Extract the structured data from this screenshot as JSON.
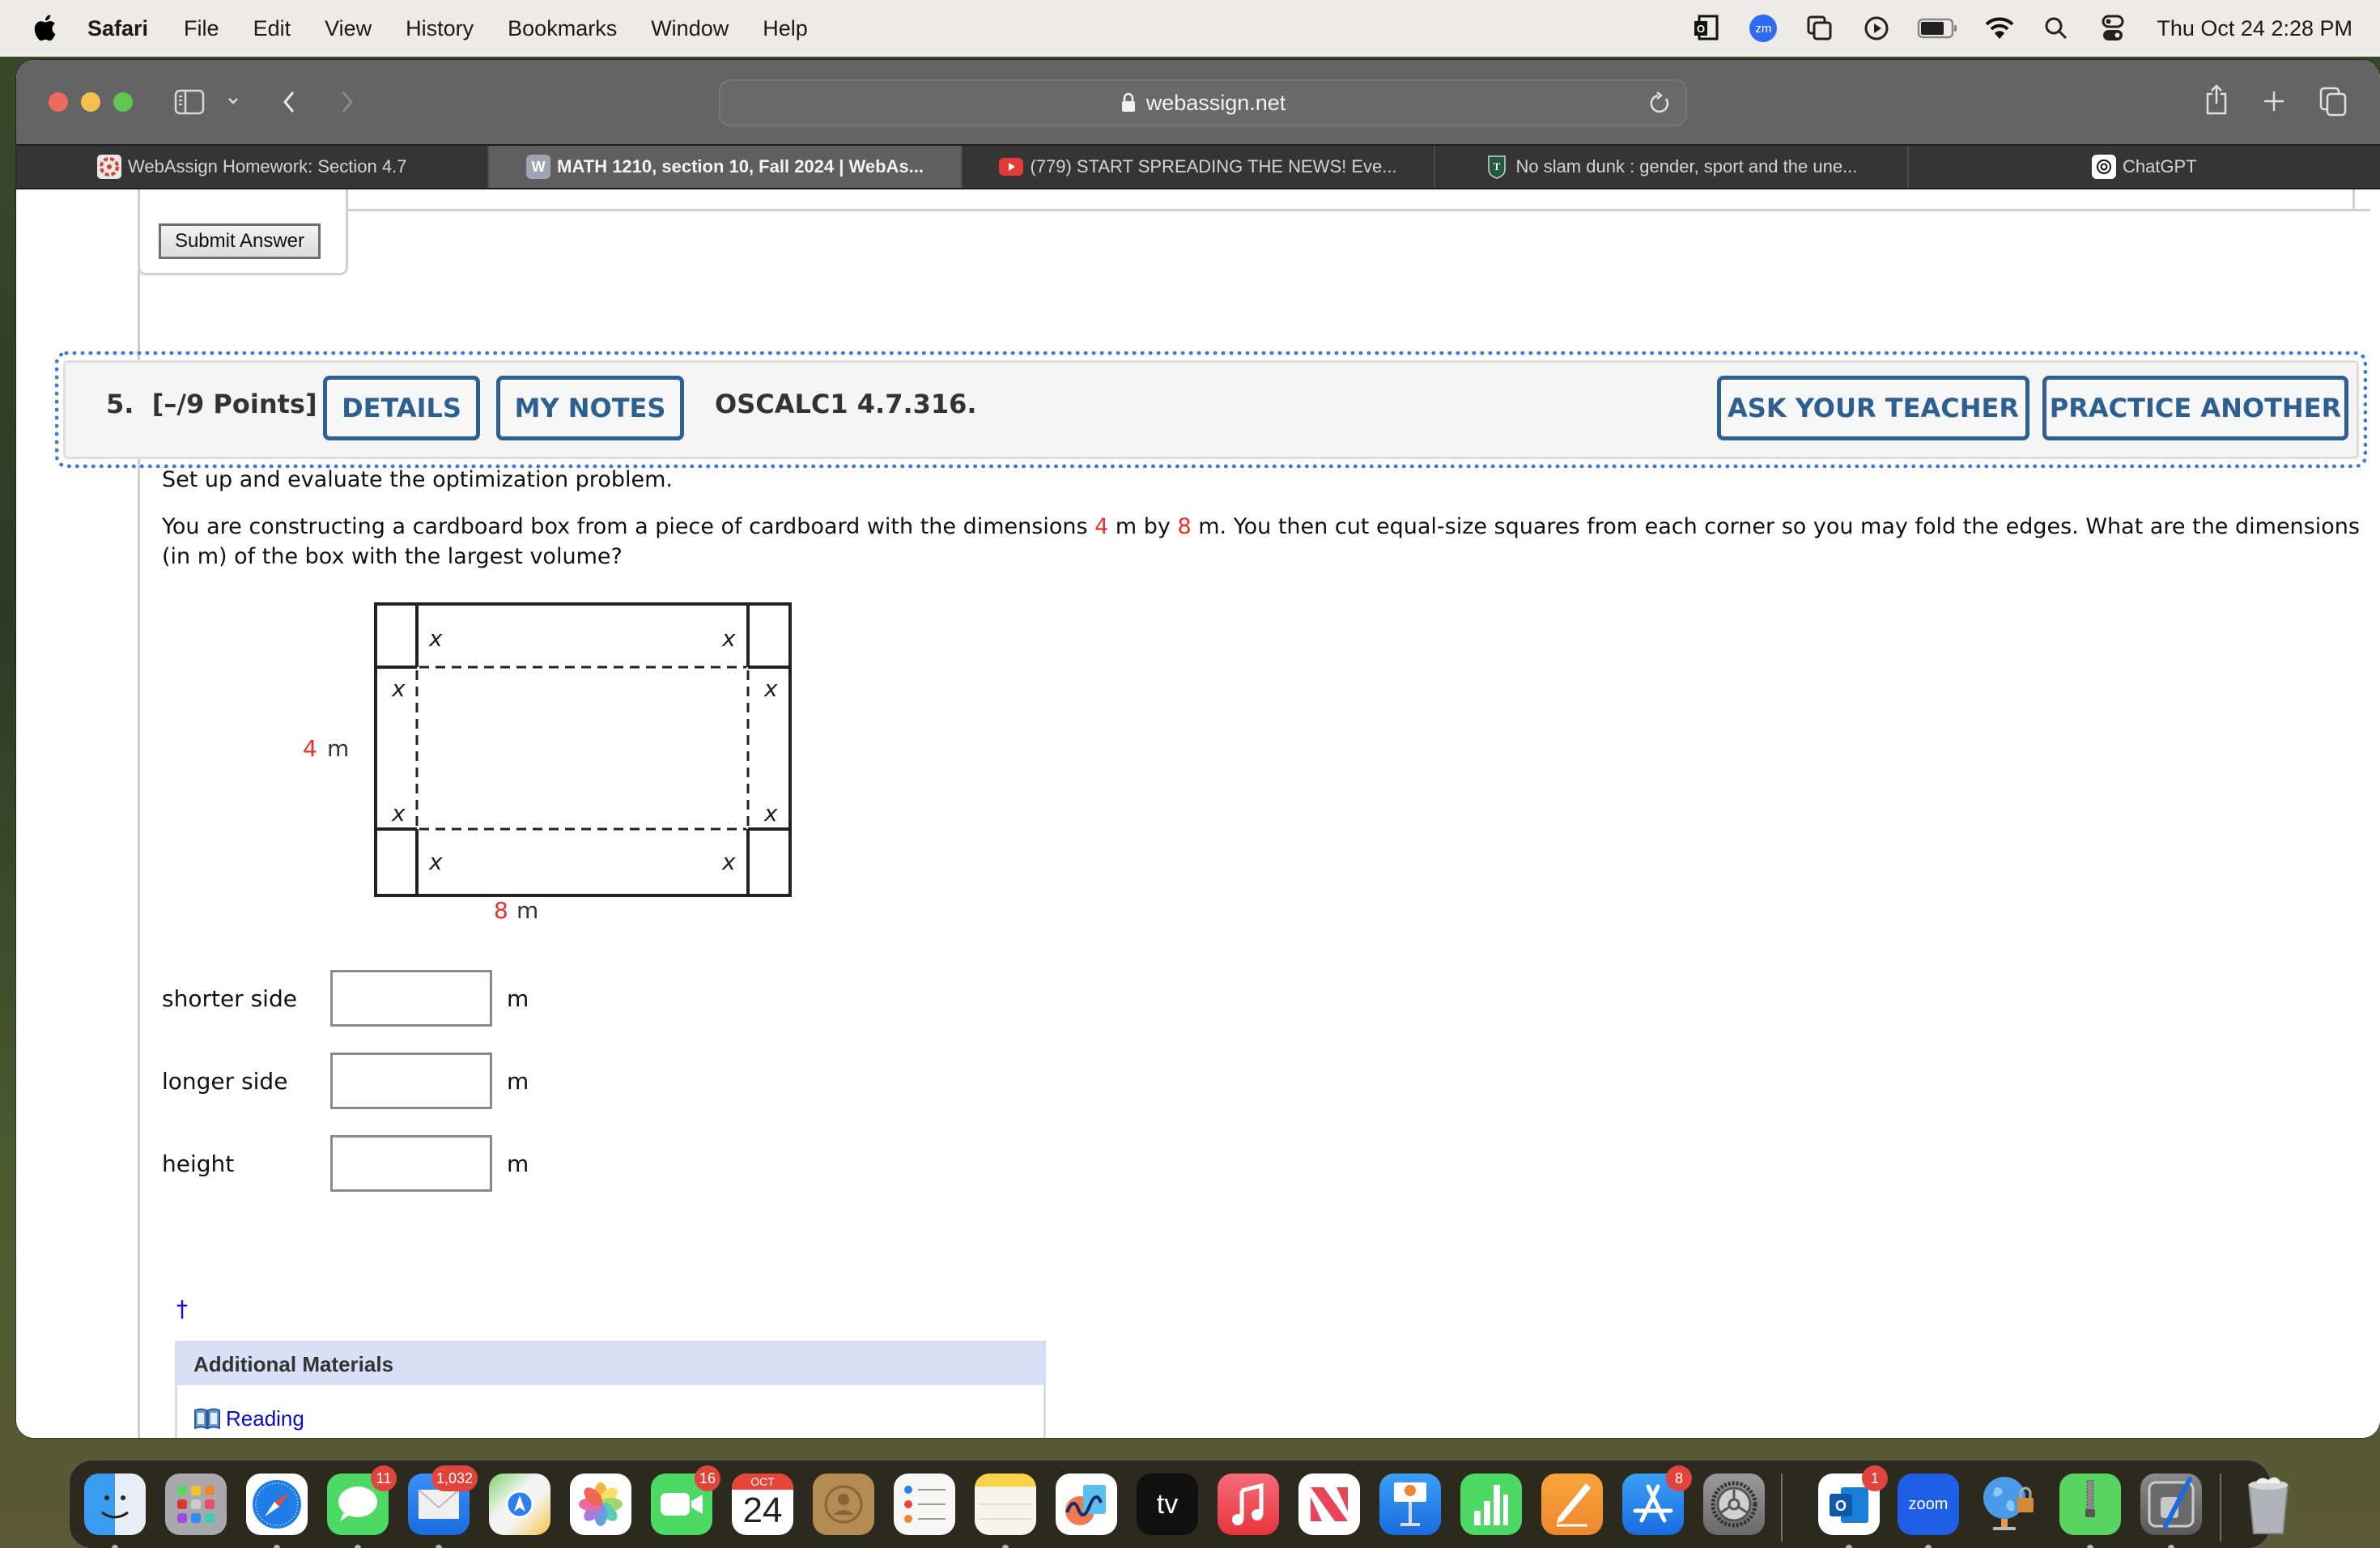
{
  "menubar": {
    "app_name": "Safari",
    "menus": [
      "File",
      "Edit",
      "View",
      "History",
      "Bookmarks",
      "Window",
      "Help"
    ],
    "status_icons": [
      "outlook-icon",
      "zoom-icon",
      "screen-mirroring-icon",
      "play-icon",
      "battery-icon",
      "wifi-icon",
      "spotlight-search-icon",
      "control-center-icon"
    ],
    "zoom_badge": "zm",
    "clock": "Thu Oct 24  2:28 PM"
  },
  "browser": {
    "url": "webassign.net",
    "tabs": [
      {
        "title": "WebAssign Homework: Section 4.7",
        "favicon": "webassign-icon",
        "active": false
      },
      {
        "title": "MATH 1210, section 10, Fall 2024 | WebAs...",
        "favicon": "W",
        "active": true
      },
      {
        "title": "(779) START SPREADING THE NEWS! Eve...",
        "favicon": "youtube-icon",
        "active": false
      },
      {
        "title": "No slam dunk : gender, sport and the une...",
        "favicon": "tulane-icon",
        "active": false
      },
      {
        "title": "ChatGPT",
        "favicon": "chatgpt-icon",
        "active": false
      }
    ]
  },
  "previous_question": {
    "submit_label": "Submit Answer"
  },
  "question": {
    "number": "5.",
    "points": "[–/9 Points]",
    "details_label": "DETAILS",
    "my_notes_label": "MY NOTES",
    "code": "OSCALC1 4.7.316.",
    "ask_teacher_label": "ASK YOUR TEACHER",
    "practice_another_label": "PRACTICE ANOTHER",
    "instruction": "Set up and evaluate the optimization problem.",
    "prompt_parts": {
      "p1": "You are constructing a cardboard box from a piece of cardboard with the dimensions ",
      "dim1": "4",
      "p2": " m by ",
      "dim2": "8",
      "p3": " m. You then cut equal-size squares from each corner so you may fold the edges. What are the dimensions",
      "line2": "(in m) of the box with the largest volume?"
    },
    "diagram": {
      "height_value": "4",
      "height_unit": "m",
      "width_value": "8",
      "width_unit": "m",
      "corner_label": "x"
    },
    "answers": [
      {
        "label": "shorter side",
        "value": "",
        "unit": "m"
      },
      {
        "label": "longer side",
        "value": "",
        "unit": "m"
      },
      {
        "label": "height",
        "value": "",
        "unit": "m"
      }
    ],
    "dagger": "†",
    "additional_materials": {
      "title": "Additional Materials",
      "link_label": "Reading"
    }
  },
  "dock": {
    "apps": [
      {
        "name": "Finder",
        "badge": null,
        "running": true
      },
      {
        "name": "Launchpad",
        "badge": null,
        "running": false
      },
      {
        "name": "Safari",
        "badge": null,
        "running": true
      },
      {
        "name": "Messages",
        "badge": "11",
        "running": true
      },
      {
        "name": "Mail",
        "badge": "1,032",
        "running": true
      },
      {
        "name": "Maps",
        "badge": null,
        "running": false
      },
      {
        "name": "Photos",
        "badge": null,
        "running": false
      },
      {
        "name": "FaceTime",
        "badge": "16",
        "running": false
      },
      {
        "name": "Calendar",
        "badge": null,
        "running": false,
        "month": "OCT",
        "day": "24"
      },
      {
        "name": "Contacts",
        "badge": null,
        "running": false
      },
      {
        "name": "Reminders",
        "badge": null,
        "running": false
      },
      {
        "name": "Notes",
        "badge": null,
        "running": true
      },
      {
        "name": "Freeform",
        "badge": null,
        "running": false
      },
      {
        "name": "TV",
        "badge": null,
        "running": false,
        "label": "tv"
      },
      {
        "name": "Music",
        "badge": null,
        "running": false
      },
      {
        "name": "News",
        "badge": null,
        "running": false
      },
      {
        "name": "Keynote",
        "badge": null,
        "running": false
      },
      {
        "name": "Numbers",
        "badge": null,
        "running": false
      },
      {
        "name": "Pages",
        "badge": null,
        "running": false
      },
      {
        "name": "App Store",
        "badge": "8",
        "running": false
      },
      {
        "name": "System Settings",
        "badge": null,
        "running": false
      },
      {
        "name": "Outlook",
        "badge": "1",
        "running": true
      },
      {
        "name": "Zoom",
        "badge": null,
        "running": true,
        "label": "zoom"
      },
      {
        "name": "Network Utility",
        "badge": null,
        "running": false
      },
      {
        "name": "Archive Utility",
        "badge": null,
        "running": true
      },
      {
        "name": "Script Editor",
        "badge": null,
        "running": true
      },
      {
        "name": "Trash",
        "badge": null,
        "running": false
      }
    ]
  }
}
